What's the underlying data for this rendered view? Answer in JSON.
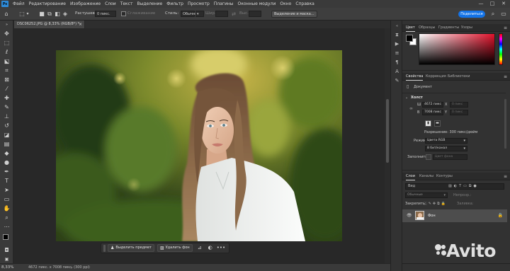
{
  "menu": {
    "app_logo": "Ps",
    "items": [
      "Файл",
      "Редактирование",
      "Изображение",
      "Слои",
      "Текст",
      "Выделение",
      "Фильтр",
      "Просмотр",
      "Плагины",
      "Оконные модули",
      "Окно",
      "Справка"
    ],
    "window_controls": [
      "—",
      "□",
      "✕"
    ]
  },
  "options": {
    "feather_label": "Растушевка:",
    "feather_value": "0 пикс.",
    "antialias_label": "Сглаживание",
    "style_label": "Стиль:",
    "style_value": "Обычный",
    "width_label": "Шир.:",
    "height_label": "Выс.:",
    "select_mask_label": "Выделение и маска...",
    "share_label": "Поделиться"
  },
  "document": {
    "tab_title": "DSC06252.JPG @ 8,33% (RGB/8*) *",
    "close": "×"
  },
  "taskbar": {
    "select_subject": "Выделить предмет",
    "remove_bg": "Удалить фон",
    "more": "•••"
  },
  "status": {
    "zoom": "8,33%",
    "doc_info": "4672 пикс. x 7008 пикс. (300 ppi)",
    "arrow": "›"
  },
  "color_panel": {
    "tabs": [
      "Цвет",
      "Образцы",
      "Градиенты",
      "Узоры"
    ],
    "active_tab": 0,
    "foreground": "#000000",
    "background": "#ffffff",
    "hue_color": "#e3122b"
  },
  "properties_panel": {
    "tabs": [
      "Свойства",
      "Коррекция",
      "Библиотеки"
    ],
    "active_tab": 0,
    "doc_type": "Документ",
    "section_canvas": "Холст",
    "width_label": "Ш",
    "width_value": "4672 пикс",
    "x_label": "X",
    "x_value": "0 пикс",
    "height_label": "В",
    "height_value": "7008 пикс",
    "y_label": "Y",
    "y_value": "0 пикс",
    "resolution": "Разрешение: 300 пикс/дюйм",
    "mode_label": "Режим",
    "mode_value": "Цвета RGB",
    "depth_value": "8 бит/канал",
    "fill_label": "Заполнить",
    "fill_value": "Цвет фона"
  },
  "layers_panel": {
    "tabs": [
      "Слои",
      "Каналы",
      "Контуры"
    ],
    "active_tab": 0,
    "search_label": "Вид",
    "blend_mode": "Обычные",
    "opacity_label": "Непрозр.:",
    "lock_label": "Закрепить:",
    "fill_label": "Заливка:",
    "layer_name": "Фон"
  },
  "watermark": {
    "text": "Avito"
  }
}
